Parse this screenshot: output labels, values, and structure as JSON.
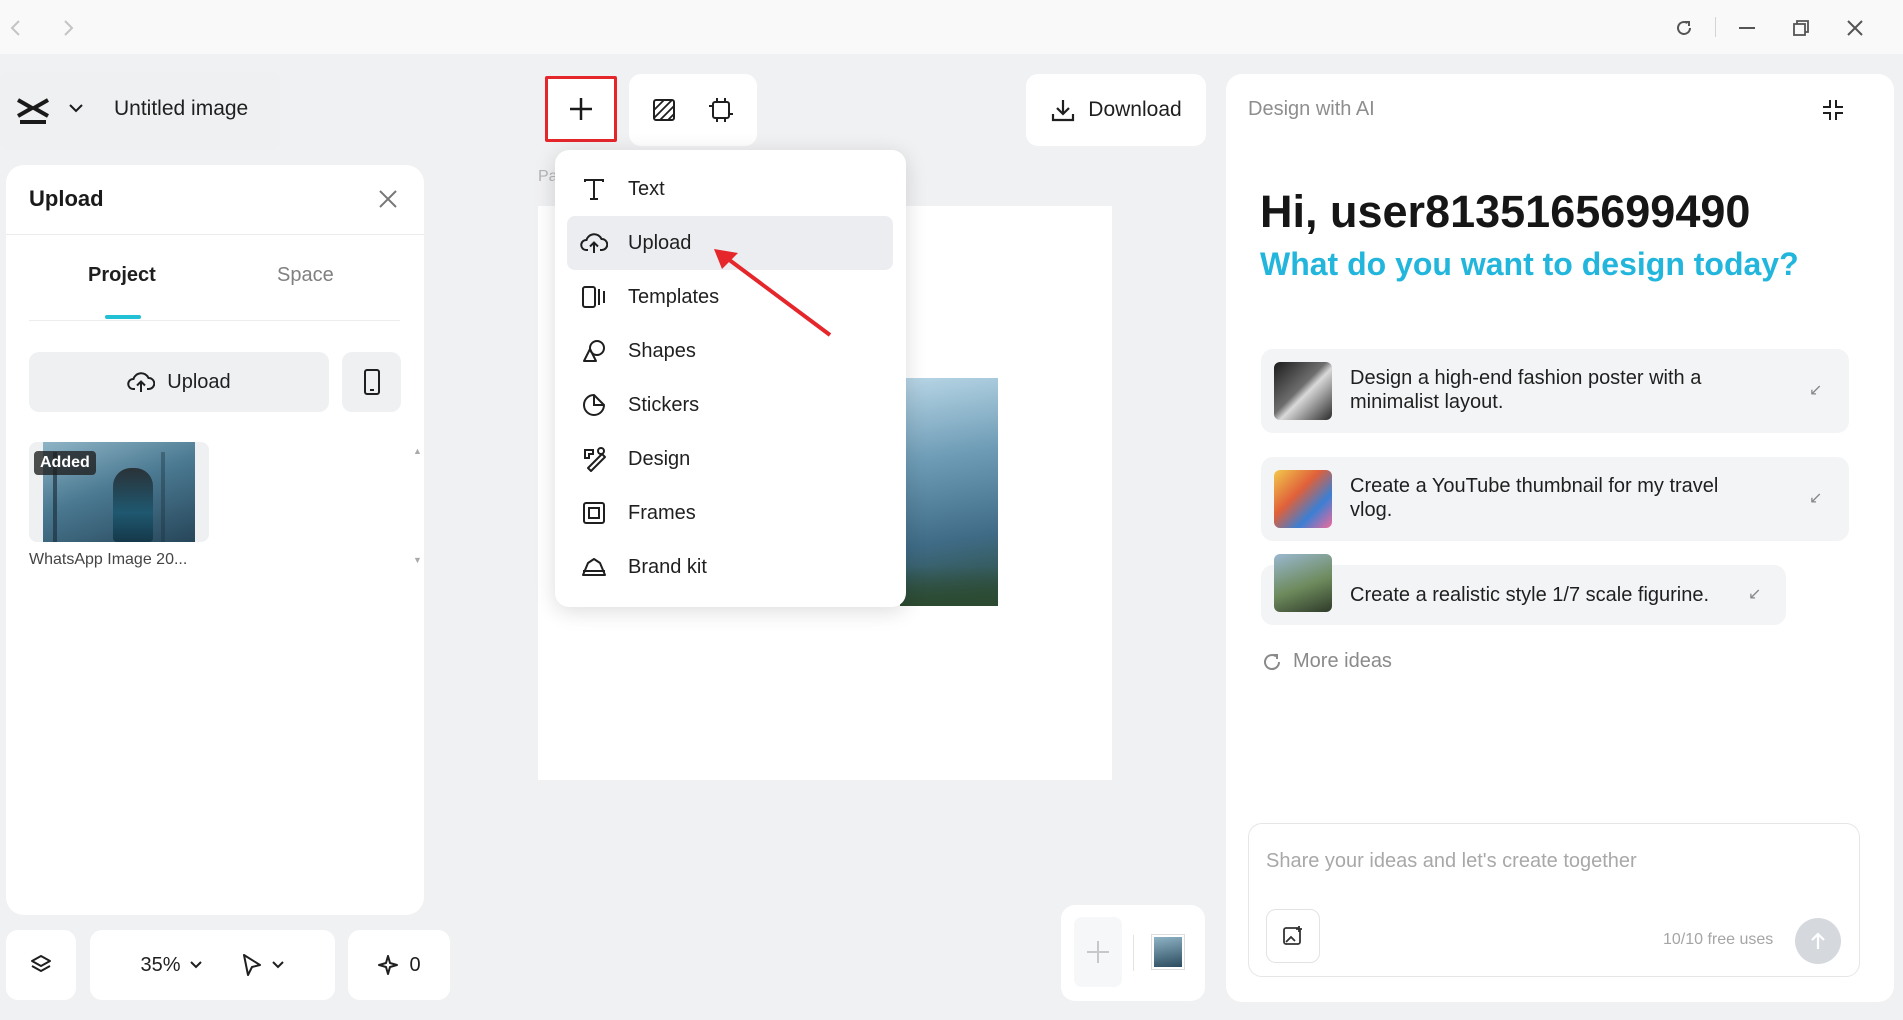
{
  "titlebar": {
    "back": "back-icon",
    "forward": "forward-icon",
    "refresh": "refresh-icon",
    "minimize": "minimize-icon",
    "restore": "restore-icon",
    "close": "close-icon"
  },
  "doc": {
    "title": "Untitled image"
  },
  "upload_panel": {
    "title": "Upload",
    "tabs": [
      {
        "label": "Project",
        "active": true
      },
      {
        "label": "Space",
        "active": false
      }
    ],
    "upload_button": "Upload",
    "items": [
      {
        "badge": "Added",
        "name": "WhatsApp Image 20..."
      }
    ]
  },
  "toolbar": {
    "download_label": "Download",
    "zoom": "35%",
    "ai_count": "0"
  },
  "canvas": {
    "page_label": "Pa"
  },
  "menu": {
    "items": [
      {
        "label": "Text",
        "icon": "text-icon"
      },
      {
        "label": "Upload",
        "icon": "cloud-upload-icon",
        "highlighted": true
      },
      {
        "label": "Templates",
        "icon": "templates-icon"
      },
      {
        "label": "Shapes",
        "icon": "shapes-icon"
      },
      {
        "label": "Stickers",
        "icon": "sticker-icon"
      },
      {
        "label": "Design",
        "icon": "design-icon"
      },
      {
        "label": "Frames",
        "icon": "frame-icon"
      },
      {
        "label": "Brand kit",
        "icon": "brand-kit-icon"
      }
    ]
  },
  "ai": {
    "title": "Design with AI",
    "greeting": "Hi, user8135165699490",
    "question": "What do you want to design today?",
    "suggestions": [
      {
        "line1": "Design a high-end fashion poster with a",
        "line2": "minimalist layout."
      },
      {
        "line1": "Create a YouTube thumbnail for my travel",
        "line2": "vlog."
      },
      {
        "line1": "Create a realistic style 1/7 scale figurine.",
        "line2": ""
      }
    ],
    "more_ideas": "More ideas",
    "input_placeholder": "Share your ideas and let's create together",
    "free_uses": "10/10 free uses"
  },
  "colors": {
    "accent": "#22c0d4",
    "highlight_box": "#e5262b",
    "ai_question": "#22b6dc"
  }
}
